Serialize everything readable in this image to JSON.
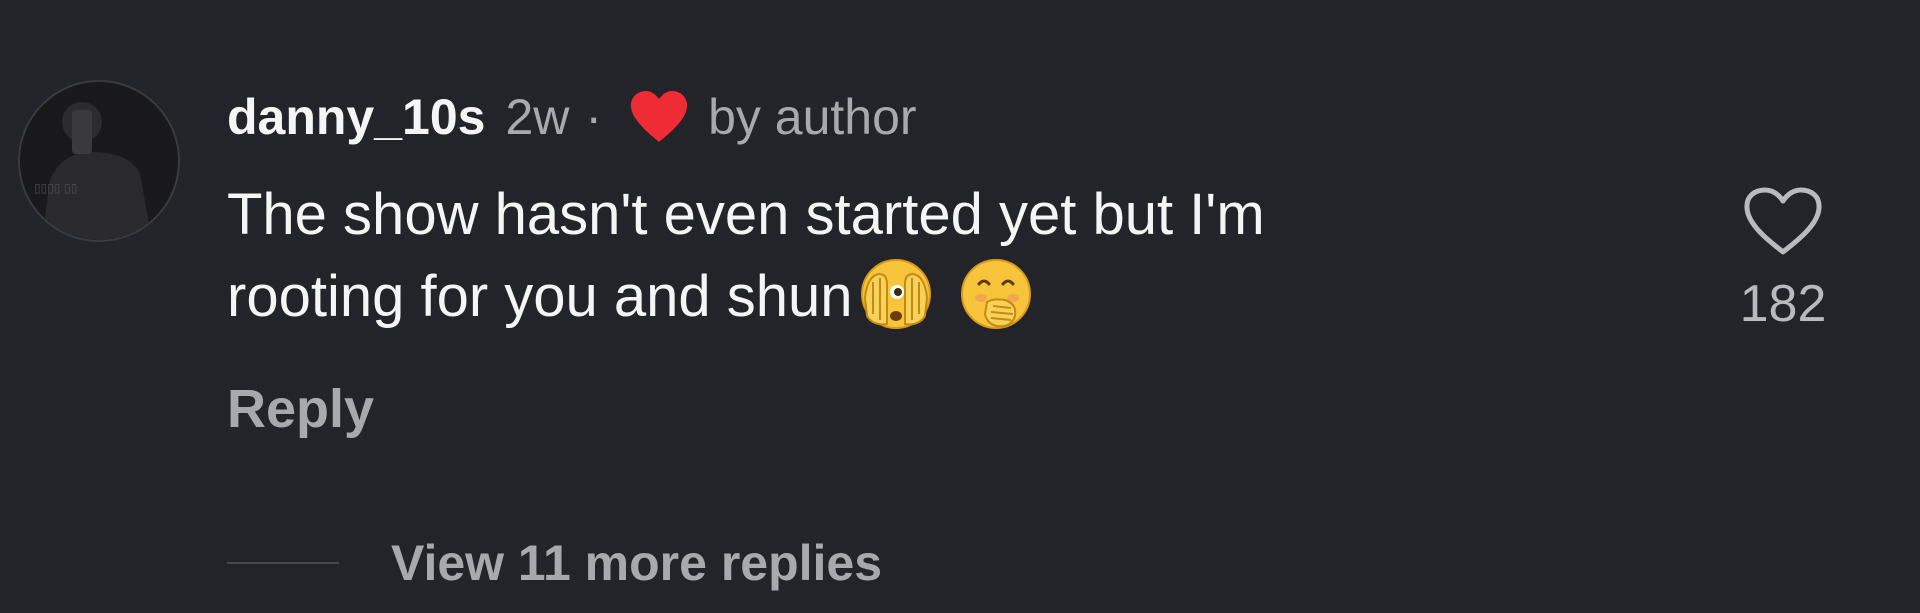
{
  "comment": {
    "username": "danny_10s",
    "time_ago": "2w",
    "separator": "·",
    "liked_by_label": "by author",
    "text_line1": "The show hasn't even started yet but I'm",
    "text_line2": "rooting for you and shun",
    "emojis": [
      "face-with-open-eyes-and-hand-over-mouth",
      "face-with-hand-over-mouth"
    ],
    "like_count": "182",
    "reply_label": "Reply",
    "view_replies_label": "View 11 more replies"
  },
  "colors": {
    "background": "#232429",
    "primary_text": "#f5f5f5",
    "secondary_text": "#a8a9ad",
    "author_heart": "#ef2b36"
  }
}
